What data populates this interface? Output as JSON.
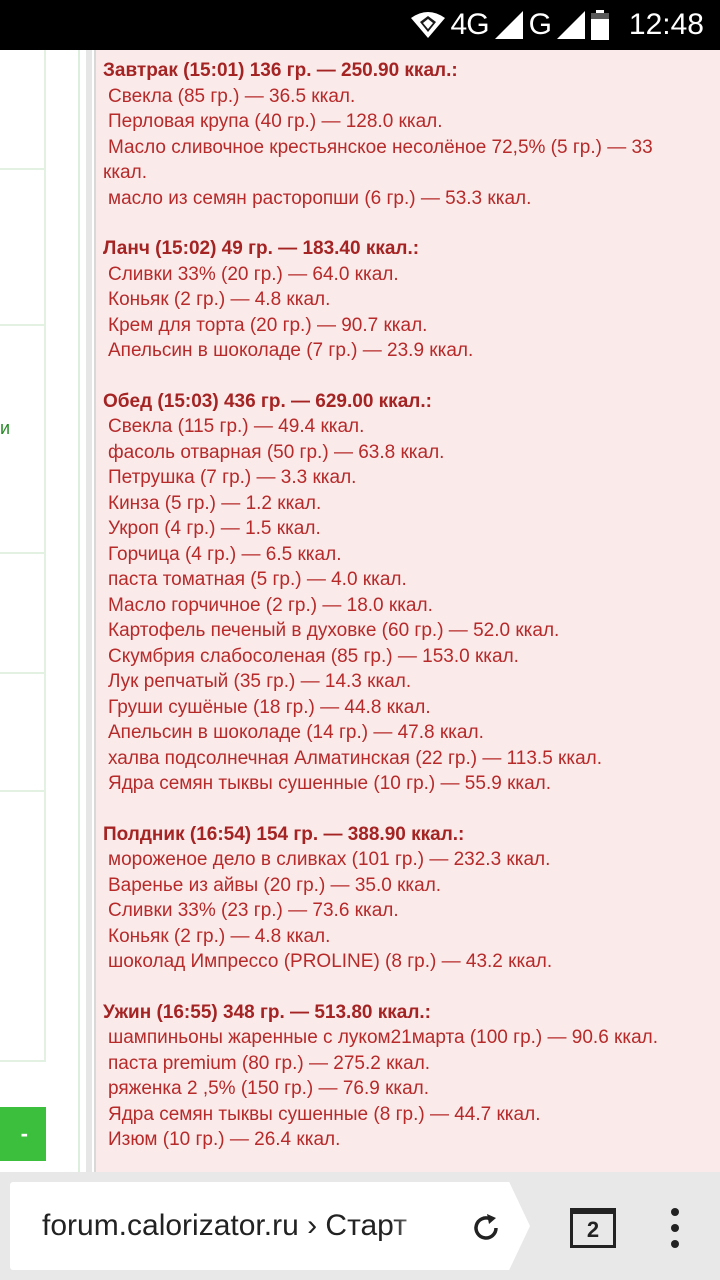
{
  "status": {
    "network": "4G",
    "network2": "G",
    "time": "12:48"
  },
  "sidebar": {
    "partial_text": "и",
    "button_label": "-"
  },
  "meals": [
    {
      "title": "Завтрак (15:01) 136 гр. — 250.90 ккал.:",
      "items": [
        "Свекла (85 гр.) — 36.5 ккал.",
        "Перловая крупа (40 гр.) — 128.0 ккал.",
        "Масло сливочное крестьянское несолёное 72,5% (5 гр.) — 33",
        "масло из семян расторопши (6 гр.) — 53.3 ккал."
      ],
      "continuation": "ккал."
    },
    {
      "title": "Ланч (15:02) 49 гр. — 183.40 ккал.:",
      "items": [
        "Сливки 33% (20 гр.) — 64.0 ккал.",
        "Коньяк (2 гр.) — 4.8 ккал.",
        "Крем для торта (20 гр.) — 90.7 ккал.",
        "Апельсин в шоколаде (7 гр.) — 23.9 ккал."
      ]
    },
    {
      "title": "Обед (15:03) 436 гр. — 629.00 ккал.:",
      "items": [
        "Свекла (115 гр.) — 49.4 ккал.",
        "фасоль отварная (50 гр.) — 63.8 ккал.",
        "Петрушка (7 гр.) — 3.3 ккал.",
        "Кинза (5 гр.) — 1.2 ккал.",
        "Укроп (4 гр.) — 1.5 ккал.",
        "Горчица (4 гр.) — 6.5 ккал.",
        "паста томатная (5 гр.) — 4.0 ккал.",
        "Масло горчичное (2 гр.) — 18.0 ккал.",
        "Картофель печеный в духовке (60 гр.) — 52.0 ккал.",
        "Скумбрия слабосоленая (85 гр.) — 153.0 ккал.",
        "Лук репчатый (35 гр.) — 14.3 ккал.",
        "Груши сушёные (18 гр.) — 44.8 ккал.",
        "Апельсин в шоколаде (14 гр.) — 47.8 ккал.",
        "халва подсолнечная Алматинская (22 гр.) — 113.5 ккал.",
        "Ядра семян тыквы сушенные (10 гр.) — 55.9 ккал."
      ]
    },
    {
      "title": "Полдник (16:54) 154 гр. — 388.90 ккал.:",
      "items": [
        "мороженое дело в сливках (101 гр.) — 232.3 ккал.",
        "Варенье из айвы (20 гр.) — 35.0 ккал.",
        "Сливки 33% (23 гр.) — 73.6 ккал.",
        "Коньяк (2 гр.) — 4.8 ккал.",
        "шоколад Импрессо (PROLINE) (8 гр.) — 43.2 ккал."
      ]
    },
    {
      "title": "Ужин (16:55) 348 гр. — 513.80 ккал.:",
      "items": [
        "шампиньоны жаренные с луком21марта (100 гр.) — 90.6 ккал.",
        "паста premium (80 гр.) — 275.2 ккал.",
        "ряженка 2 ,5% (150 гр.) — 76.9 ккал.",
        "Ядра семян тыквы сушенные (8 гр.) — 44.7 ккал.",
        "Изюм (10 гр.) — 26.4 ккал."
      ]
    }
  ],
  "browser": {
    "url": "forum.calorizator.ru › Старт",
    "tab_count": "2"
  }
}
